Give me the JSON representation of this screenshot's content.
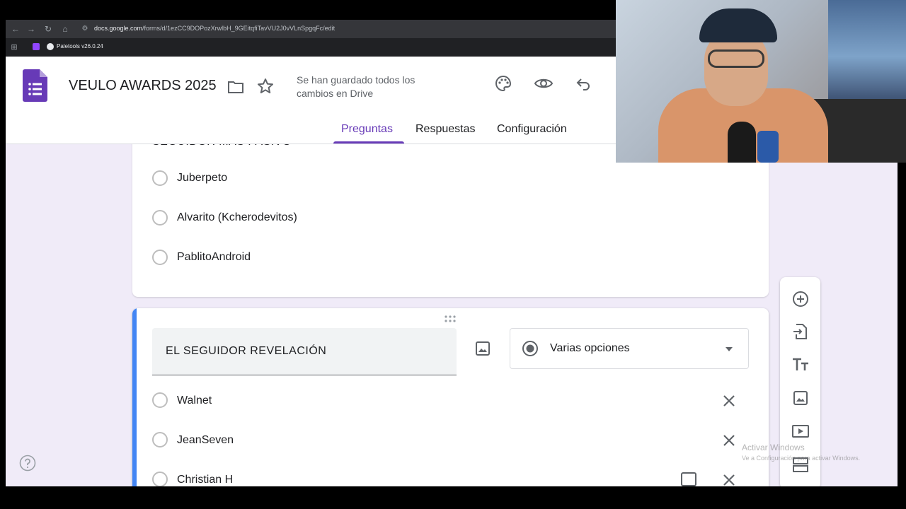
{
  "browser": {
    "url_domain": "docs.google.com",
    "url_path": "/forms/d/1ezCC9DOPozXrwlbH_9GEitqfiTavVU2J0vVLnSpgqFc/edit",
    "bookmark": "Paletools v26.0.24"
  },
  "header": {
    "title": "VEULO AWARDS 2025",
    "save_status_line1": "Se han guardado todos los",
    "save_status_line2": "cambios en Drive",
    "tabs": [
      {
        "label": "Preguntas",
        "active": true
      },
      {
        "label": "Respuestas",
        "active": false
      },
      {
        "label": "Configuración",
        "active": false
      }
    ],
    "accent_color": "#673ab7"
  },
  "question1": {
    "title_partial": "SEGUIDOR MAS PASIVO",
    "options": [
      "Juberpeto",
      "Alvarito (Kcherodevitos)",
      "PablitoAndroid"
    ]
  },
  "question2": {
    "title": "EL SEGUIDOR REVELACIÓN",
    "type_label": "Varias opciones",
    "options": [
      "Walnet",
      "JeanSeven",
      "Christian H"
    ],
    "accent_color": "#4285f4"
  },
  "sidebar": {
    "items": [
      "add-question",
      "import-questions",
      "add-title",
      "add-image",
      "add-video",
      "add-section"
    ]
  },
  "watermark": {
    "line1": "Activar Windows",
    "line2": "Ve a Configuración para activar Windows."
  }
}
